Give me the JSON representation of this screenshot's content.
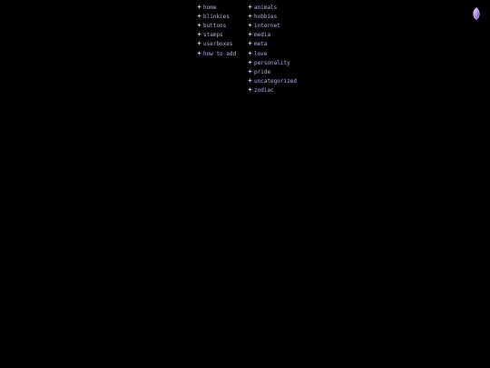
{
  "nav": {
    "left": [
      {
        "label": "home",
        "key": "home"
      },
      {
        "label": "blinkies",
        "key": "blinkies"
      },
      {
        "label": "buttons",
        "key": "buttons"
      },
      {
        "label": "stamps",
        "key": "stamps"
      },
      {
        "label": "userboxes",
        "key": "userboxes"
      },
      {
        "label": "how to add",
        "key": "how-to-add"
      }
    ],
    "right": [
      {
        "label": "animals",
        "key": "animals"
      },
      {
        "label": "hobbies",
        "key": "hobbies"
      },
      {
        "label": "internet",
        "key": "internet"
      },
      {
        "label": "media",
        "key": "media"
      },
      {
        "label": "meta",
        "key": "meta"
      },
      {
        "label": "love",
        "key": "love"
      },
      {
        "label": "personality",
        "key": "personality"
      },
      {
        "label": "pride",
        "key": "pride"
      },
      {
        "label": "uncategorized",
        "key": "uncategorized"
      },
      {
        "label": "zodiac",
        "key": "zodiac"
      }
    ]
  },
  "icons": {
    "bullet": "star-bullet-icon",
    "corner": "gem-icon"
  },
  "colors": {
    "background": "#000000",
    "link": "#bcaee6",
    "bullet": "#c9bff5",
    "gem": "#a98bf0"
  }
}
